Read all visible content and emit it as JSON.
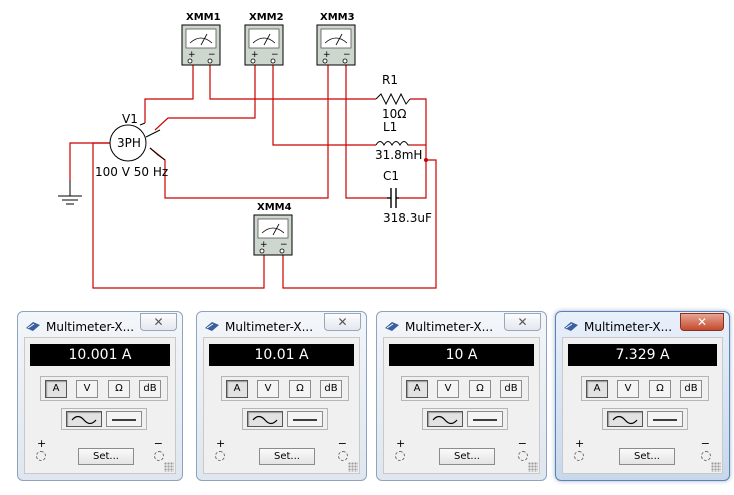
{
  "schematic": {
    "instruments": [
      {
        "label": "XMM1"
      },
      {
        "label": "XMM2"
      },
      {
        "label": "XMM3"
      },
      {
        "label": "XMM4"
      }
    ],
    "source": {
      "label": "V1",
      "symbol": "3PH",
      "rating": "100 V 50 Hz"
    },
    "components": [
      {
        "ref": "R1",
        "value": "10Ω"
      },
      {
        "ref": "L1",
        "value": "31.8mH"
      },
      {
        "ref": "C1",
        "value": "318.3uF"
      }
    ],
    "wire_color": "#cc0000"
  },
  "multimeters": [
    {
      "title": "Multimeter-X...",
      "reading": "10.001 A",
      "modes": [
        "A",
        "V",
        "Ω",
        "dB"
      ],
      "selected_mode": "A",
      "wave": "AC",
      "set_label": "Set...",
      "close_label": "✕",
      "plus": "+",
      "minus": "−"
    },
    {
      "title": "Multimeter-X...",
      "reading": "10.01 A",
      "modes": [
        "A",
        "V",
        "Ω",
        "dB"
      ],
      "selected_mode": "A",
      "wave": "AC",
      "set_label": "Set...",
      "close_label": "✕",
      "plus": "+",
      "minus": "−"
    },
    {
      "title": "Multimeter-X...",
      "reading": "10 A",
      "modes": [
        "A",
        "V",
        "Ω",
        "dB"
      ],
      "selected_mode": "A",
      "wave": "AC",
      "set_label": "Set...",
      "close_label": "✕",
      "plus": "+",
      "minus": "−"
    },
    {
      "title": "Multimeter-X...",
      "reading": "7.329 A",
      "modes": [
        "A",
        "V",
        "Ω",
        "dB"
      ],
      "selected_mode": "A",
      "wave": "AC",
      "set_label": "Set...",
      "close_label": "✕",
      "plus": "+",
      "minus": "−",
      "active": true
    }
  ]
}
